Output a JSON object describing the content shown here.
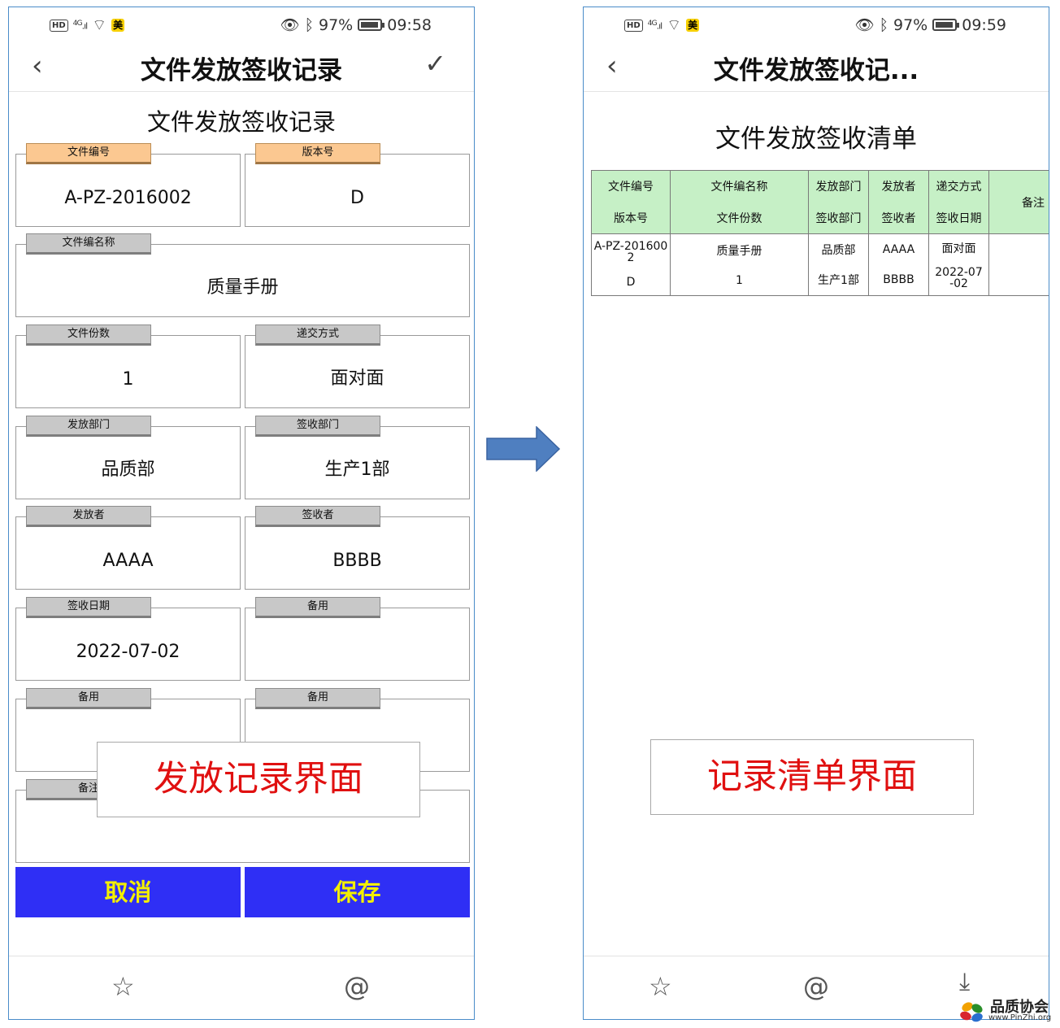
{
  "left_screen": {
    "status": {
      "net": "4G",
      "badge": "美",
      "battery": "97%",
      "time": "09:58"
    },
    "title": "文件发放签收记录",
    "form_title": "文件发放签收记录",
    "fields": {
      "doc_no": {
        "label": "文件编号",
        "value": "A-PZ-2016002"
      },
      "version": {
        "label": "版本号",
        "value": "D"
      },
      "doc_name": {
        "label": "文件编名称",
        "value": "质量手册"
      },
      "copies": {
        "label": "文件份数",
        "value": "1"
      },
      "delivery": {
        "label": "递交方式",
        "value": "面对面"
      },
      "issue_dept": {
        "label": "发放部门",
        "value": "品质部"
      },
      "recv_dept": {
        "label": "签收部门",
        "value": "生产1部"
      },
      "issuer": {
        "label": "发放者",
        "value": "AAAA"
      },
      "receiver": {
        "label": "签收者",
        "value": "BBBB"
      },
      "recv_date": {
        "label": "签收日期",
        "value": "2022-07-02"
      },
      "spare1": {
        "label": "备用",
        "value": ""
      },
      "spare2": {
        "label": "备用",
        "value": ""
      },
      "spare3": {
        "label": "备用",
        "value": ""
      },
      "remark": {
        "label": "备注",
        "value": ""
      }
    },
    "buttons": {
      "cancel": "取消",
      "save": "保存"
    },
    "overlay": "发放记录界面"
  },
  "right_screen": {
    "status": {
      "net": "4G",
      "badge": "美",
      "battery": "97%",
      "time": "09:59"
    },
    "title": "文件发放签收记...",
    "list_title": "文件发放签收清单",
    "table": {
      "headers": [
        [
          "文件编号",
          "版本号"
        ],
        [
          "文件编名称",
          "文件份数"
        ],
        [
          "发放部门",
          "签收部门"
        ],
        [
          "发放者",
          "签收者"
        ],
        [
          "递交方式",
          "签收日期"
        ],
        [
          "备注"
        ]
      ],
      "row": [
        [
          "A-PZ-2016002",
          "D"
        ],
        [
          "质量手册",
          "1"
        ],
        [
          "品质部",
          "生产1部"
        ],
        [
          "AAAA",
          "BBBB"
        ],
        [
          "面对面",
          "2022-07-02"
        ],
        [
          ""
        ]
      ]
    },
    "overlay": "记录清单界面"
  },
  "icons": {
    "back": "chevron-left-icon",
    "confirm": "check-icon",
    "favorite": "star-icon",
    "mention": "at-icon",
    "download": "download-icon",
    "flow": "right-arrow-icon"
  },
  "colors": {
    "button_bg": "#2f2ff5",
    "button_text": "#f3ef00",
    "label_orange": "#fbc891",
    "label_gray": "#c8c8c8",
    "header_green": "#c6f0c6",
    "overlay_text": "#e01010",
    "arrow": "#4f7fc0"
  },
  "watermark": {
    "name": "品质协会",
    "url": "www.PinZhi.org"
  }
}
